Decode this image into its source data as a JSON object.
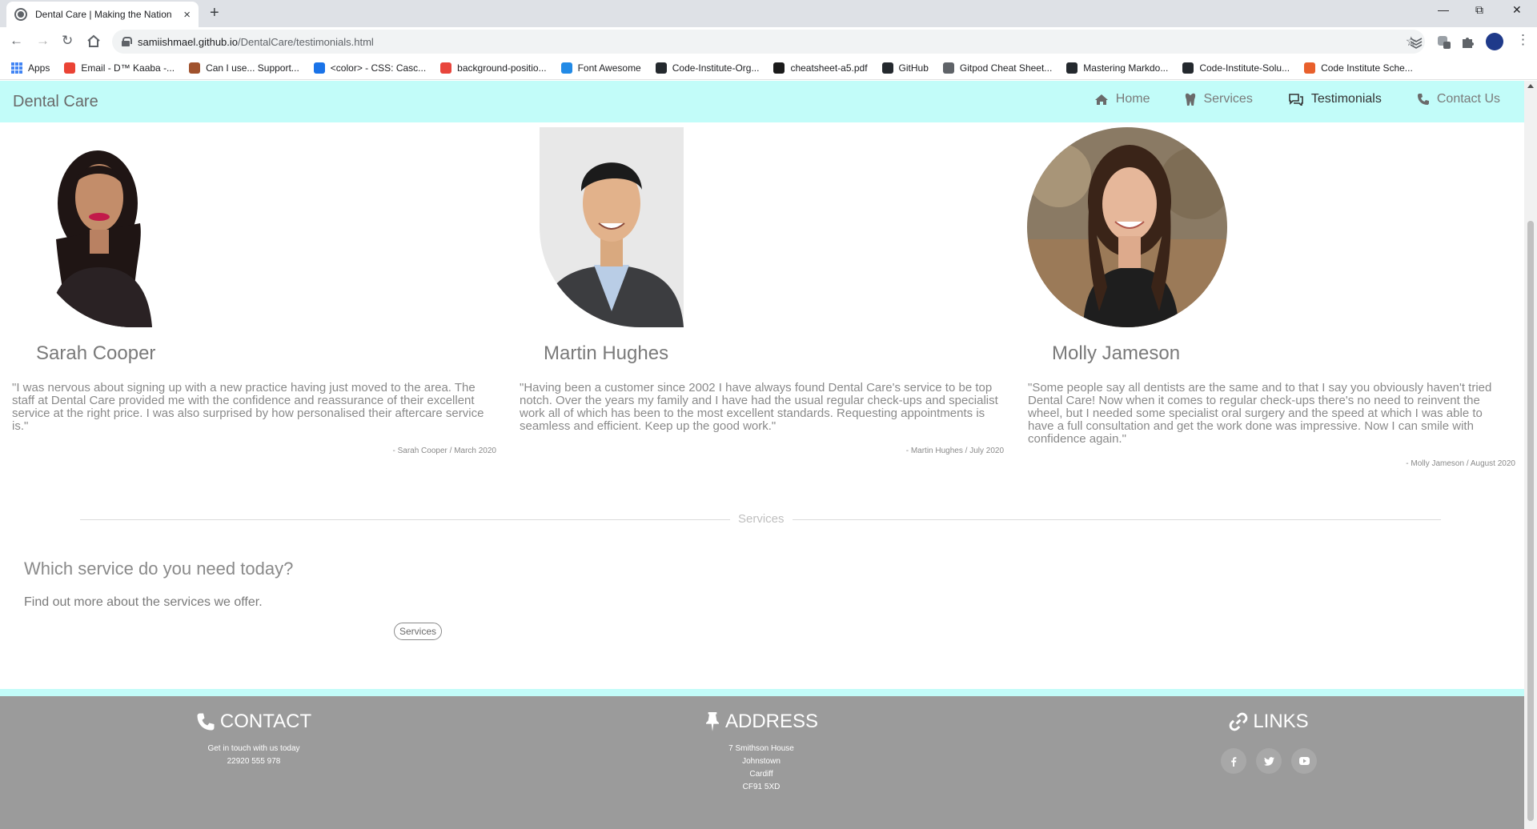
{
  "browser": {
    "tab_title": "Dental Care | Making the Nation",
    "tab_close": "×",
    "new_tab": "+",
    "url_host": "samiishmael.github.io",
    "url_path": "/DentalCare/testimonials.html",
    "bookmarks": [
      {
        "label": "Apps",
        "color": "#4285f4"
      },
      {
        "label": "Email - D™ Kaaba -...",
        "color": "#ea4335"
      },
      {
        "label": "Can I use... Support...",
        "color": "#a0522d"
      },
      {
        "label": "<color> - CSS: Casc...",
        "color": "#1a73e8"
      },
      {
        "label": "background-positio...",
        "color": "#e8453c"
      },
      {
        "label": "Font Awesome",
        "color": "#228ae6"
      },
      {
        "label": "Code-Institute-Org...",
        "color": "#24292e"
      },
      {
        "label": "cheatsheet-a5.pdf",
        "color": "#1b1b1b"
      },
      {
        "label": "GitHub",
        "color": "#24292e"
      },
      {
        "label": "Gitpod Cheat Sheet...",
        "color": "#5f6368"
      },
      {
        "label": "Mastering Markdo...",
        "color": "#24292e"
      },
      {
        "label": "Code-Institute-Solu...",
        "color": "#24292e"
      },
      {
        "label": "Code Institute Sche...",
        "color": "#e8602c"
      }
    ]
  },
  "site": {
    "brand": "Dental Care",
    "nav": [
      {
        "label": "Home",
        "icon": "home-icon",
        "active": false
      },
      {
        "label": "Services",
        "icon": "tooth-icon",
        "active": false
      },
      {
        "label": "Testimonials",
        "icon": "comments-icon",
        "active": true
      },
      {
        "label": "Contact Us",
        "icon": "phone-icon",
        "active": false
      }
    ],
    "accent_color": "#c2fcf9"
  },
  "testimonials": [
    {
      "name": "Sarah Cooper",
      "quote": "\"I was nervous about signing up with a new practice having just moved to the area. The staff at Dental Care provided me with the confidence and reassurance of their excellent service at the right price. I was also surprised by how personalised their aftercare service is.\"",
      "signature": "- Sarah Cooper / March 2020"
    },
    {
      "name": "Martin Hughes",
      "quote": "\"Having been a customer since 2002 I have always found Dental Care's service to be top notch. Over the years my family and I have had the usual regular check-ups and specialist work all of which has been to the most excellent standards. Requesting appointments is seamless and efficient. Keep up the good work.\"",
      "signature": "- Martin Hughes / July 2020"
    },
    {
      "name": "Molly Jameson",
      "quote": "\"Some people say all dentists are the same and to that I say you obviously haven't tried Dental Care! Now when it comes to regular check-ups there's no need to reinvent the wheel, but I needed some specialist oral surgery and the speed at which I was able to have a full consultation and get the work done was impressive. Now I can smile with confidence again.\"",
      "signature": "- Molly Jameson / August 2020"
    }
  ],
  "services_section": {
    "divider_label": "Services",
    "heading": "Which service do you need today?",
    "text": "Find out more about the services we offer.",
    "button": "Services"
  },
  "footer": {
    "contact": {
      "title": "CONTACT",
      "icon": "phone-icon",
      "lines": [
        "Get in touch with us today",
        "22920 555 978"
      ]
    },
    "address": {
      "title": "ADDRESS",
      "icon": "pin-icon",
      "lines": [
        "7 Smithson House",
        "Johnstown",
        "Cardiff",
        "CF91 5XD"
      ]
    },
    "links": {
      "title": "LINKS",
      "icon": "link-icon",
      "social": [
        "facebook-icon",
        "twitter-icon",
        "youtube-icon"
      ]
    }
  }
}
